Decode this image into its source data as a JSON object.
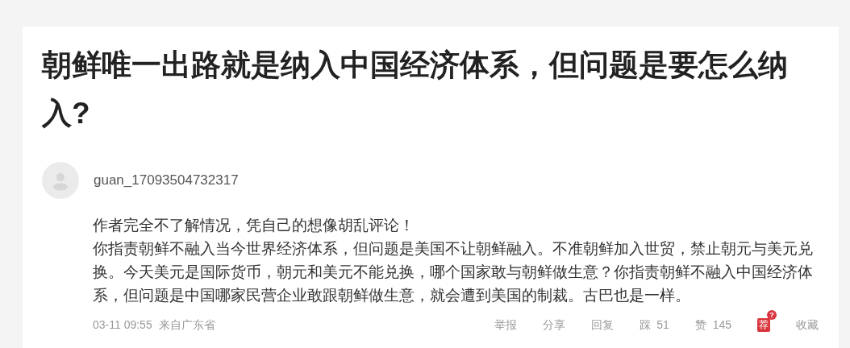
{
  "title": "朝鲜唯一出路就是纳入中国经济体系，但问题是要怎么纳入?",
  "comment": {
    "author": "guan_17093504732317",
    "lines": [
      "作者完全不了解情况，凭自己的想像胡乱评论！",
      "你指责朝鲜不融入当今世界经济体系，但问题是美国不让朝鲜融入。不准朝鲜加入世贸，禁止朝元与美元兑换。今天美元是国际货币，朝元和美元不能兑换，哪个国家敢与朝鲜做生意？你指责朝鲜不融入中国经济体系，但问题是中国哪家民营企业敢跟朝鲜做生意，就会遭到美国的制裁。古巴也是一样。"
    ],
    "time": "03-11 09:55",
    "location": "来自广东省",
    "actions": [
      {
        "kind": "text",
        "label": "举报"
      },
      {
        "kind": "text",
        "label": "分享"
      },
      {
        "kind": "text",
        "label": "回复"
      },
      {
        "kind": "count",
        "label": "踩",
        "count": "51"
      },
      {
        "kind": "count",
        "label": "赞",
        "count": "145"
      },
      {
        "kind": "badge",
        "label": "荐",
        "badge": "?"
      },
      {
        "kind": "text",
        "label": "收藏"
      }
    ]
  }
}
